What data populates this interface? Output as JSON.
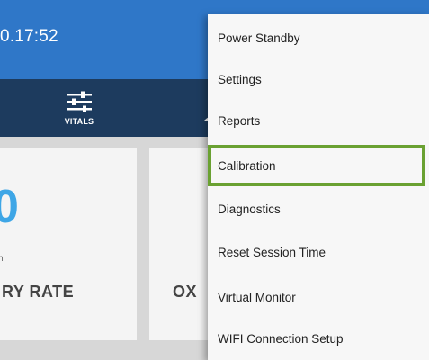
{
  "header": {
    "time": "0.17:52"
  },
  "nav": {
    "tabs": [
      {
        "label": "VITALS"
      }
    ]
  },
  "cards": [
    {
      "value": "0",
      "unit": "n",
      "title": "RY RATE"
    },
    {
      "title": "OX"
    }
  ],
  "menu": {
    "items": [
      {
        "label": "Power Standby"
      },
      {
        "label": "Settings"
      },
      {
        "label": "Reports"
      },
      {
        "label": "Calibration"
      },
      {
        "label": "Diagnostics"
      },
      {
        "label": "Reset Session Time"
      },
      {
        "label": "Virtual Monitor"
      },
      {
        "label": "WIFI Connection Setup"
      }
    ],
    "selected_index": 3
  },
  "colors": {
    "header_blue": "#2f77c8",
    "nav_dark": "#1d3b5e",
    "accent_value": "#3ea6e6",
    "selection_green": "#6aa132"
  }
}
